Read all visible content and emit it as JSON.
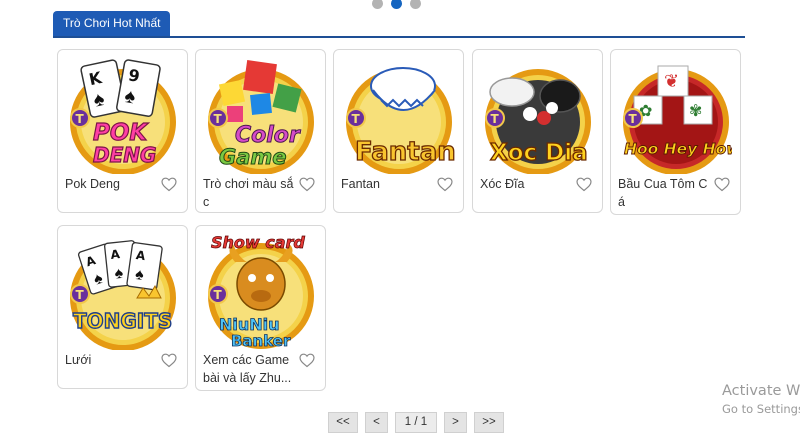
{
  "section": {
    "tab_label": "Trò Chơi Hot Nhất"
  },
  "carousel": {
    "dot_count": 3,
    "active_index": 1
  },
  "games": [
    {
      "name": "Pok Deng",
      "logo_text": [
        "POK",
        "DENG"
      ],
      "icon": "pok-deng-cards-icon"
    },
    {
      "name": "Trò chơi màu sắc",
      "logo_text": [
        "Color",
        "Game"
      ],
      "icon": "color-game-cubes-icon"
    },
    {
      "name": "Fantan",
      "logo_text": [
        "Fantan"
      ],
      "icon": "fantan-bowl-icon"
    },
    {
      "name": "Xóc Đĩa",
      "logo_text": [
        "Xoc Dia"
      ],
      "icon": "xoc-dia-plate-icon"
    },
    {
      "name": "Bầu Cua Tôm Cá",
      "logo_text": [
        "Hoo Hey How"
      ],
      "icon": "hoo-hey-how-dice-icon"
    },
    {
      "name": "Lưới",
      "logo_text": [
        "TONGITS"
      ],
      "icon": "tongits-cards-icon"
    },
    {
      "name": "Xem các Game bài và lấy Zhu...",
      "logo_text": [
        "Show card",
        "NiuNiu",
        "Banker"
      ],
      "icon": "niuniu-bull-icon"
    }
  ],
  "pagination": {
    "first": "<<",
    "prev": "<",
    "info": "1 / 1",
    "next": ">",
    "last": ">>"
  },
  "watermark": {
    "line1": "Activate W",
    "line2": "Go to Settings"
  },
  "colors": {
    "accent": "#1e5bb5",
    "header_line": "#1e4f95",
    "dot_active": "#1565c0",
    "dot": "#b3b3b3",
    "badge": "#6a2f9c",
    "ring": "#f2b01e"
  }
}
